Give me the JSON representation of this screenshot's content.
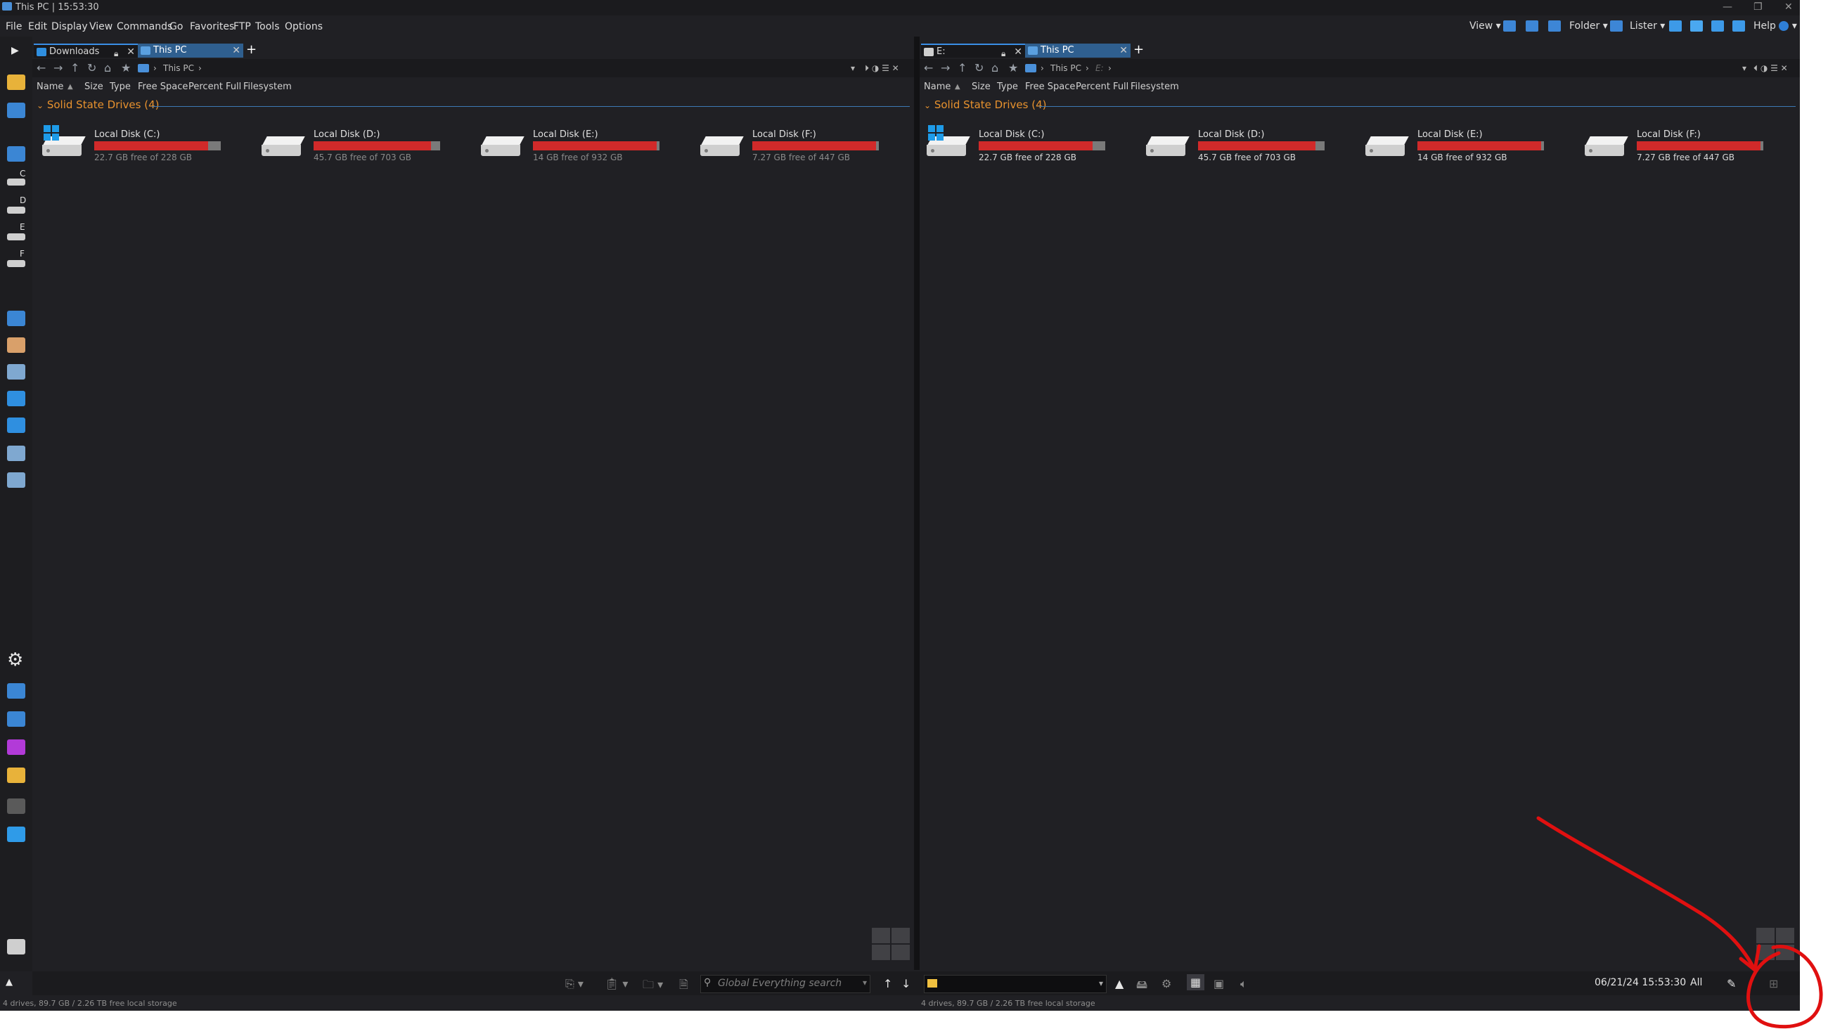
{
  "window": {
    "title": "This PC | 15:53:30"
  },
  "menu": [
    "File",
    "Edit",
    "Display",
    "View",
    "Commands",
    "Go",
    "Favorites",
    "FTP",
    "Tools",
    "Options"
  ],
  "toolbar_right": {
    "view": "View",
    "folder": "Folder",
    "lister": "Lister",
    "help": "Help"
  },
  "panes": [
    {
      "tabs": [
        {
          "label": "Downloads",
          "locked": true
        },
        {
          "label": "This PC",
          "active": true
        }
      ],
      "breadcrumb": [
        "This PC"
      ],
      "columns": [
        "Name",
        "Size",
        "Type",
        "Free Space",
        "Percent Full",
        "Filesystem"
      ],
      "group": "Solid State Drives (4)",
      "drives": [
        {
          "name": "Local Disk (C:)",
          "free": "22.7 GB free of 228 GB",
          "percent_full": 90,
          "system": true
        },
        {
          "name": "Local Disk (D:)",
          "free": "45.7 GB free of 703 GB",
          "percent_full": 93
        },
        {
          "name": "Local Disk (E:)",
          "free": "14 GB free of 932 GB",
          "percent_full": 98
        },
        {
          "name": "Local Disk (F:)",
          "free": "7.27 GB free of 447 GB",
          "percent_full": 98
        }
      ]
    },
    {
      "tabs": [
        {
          "label": "E:",
          "locked": true
        },
        {
          "label": "This PC",
          "active": true
        }
      ],
      "breadcrumb": [
        "This PC",
        "E:"
      ],
      "columns": [
        "Name",
        "Size",
        "Type",
        "Free Space",
        "Percent Full",
        "Filesystem"
      ],
      "group": "Solid State Drives (4)",
      "drives": [
        {
          "name": "Local Disk (C:)",
          "free": "22.7 GB free of 228 GB",
          "percent_full": 90,
          "system": true
        },
        {
          "name": "Local Disk (D:)",
          "free": "45.7 GB free of 703 GB",
          "percent_full": 93
        },
        {
          "name": "Local Disk (E:)",
          "free": "14 GB free of 932 GB",
          "percent_full": 98
        },
        {
          "name": "Local Disk (F:)",
          "free": "7.27 GB free of 447 GB",
          "percent_full": 98
        }
      ]
    }
  ],
  "sidebar_drive_letters": [
    "C",
    "D",
    "E",
    "F"
  ],
  "bottom": {
    "search_placeholder": "Global Everything search",
    "clock": "06/21/24 15:53:30",
    "all_label": "All"
  },
  "status": {
    "left": "4 drives, 89.7 GB / 2.26 TB free local storage",
    "right": "4 drives, 89.7 GB / 2.26 TB free local storage"
  },
  "colors": {
    "accent": "#3a8ee6",
    "group_label": "#e8922e",
    "bar_fill": "#d12a2a",
    "annotation": "#e01010"
  }
}
